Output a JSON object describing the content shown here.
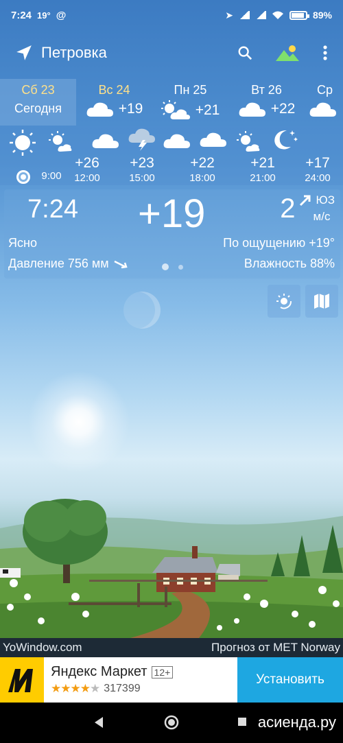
{
  "statusbar": {
    "time": "7:24",
    "temp_small": "19°",
    "battery": "89%"
  },
  "appbar": {
    "location": "Петровка"
  },
  "days": [
    {
      "name": "Сб 23",
      "sub": "Сегодня",
      "temp": "",
      "active": true
    },
    {
      "name": "Вс 24",
      "sub": "",
      "temp": "+19",
      "icon": "cloud-icon"
    },
    {
      "name": "Пн 25",
      "sub": "",
      "temp": "+21",
      "icon": "sun-cloud-icon"
    },
    {
      "name": "Вт 26",
      "sub": "",
      "temp": "+22",
      "icon": "cloud-icon"
    },
    {
      "name": "Ср",
      "sub": "",
      "temp": "",
      "icon": "cloud-icon"
    }
  ],
  "hours": [
    {
      "time": "9:00",
      "temp": "",
      "icon": "sun-icon"
    },
    {
      "time": "12:00",
      "temp": "+26",
      "icon": "sun-small-cloud-icon"
    },
    {
      "time": "15:00",
      "temp": "+23",
      "icon": "thunder-cloud-icon"
    },
    {
      "time": "18:00",
      "temp": "+22",
      "icon": "cloud-icon"
    },
    {
      "time": "21:00",
      "temp": "+21",
      "icon": "sun-small-cloud-icon"
    },
    {
      "time": "24:00",
      "temp": "+17",
      "icon": "moon-stars-icon"
    }
  ],
  "current": {
    "time": "7:24",
    "temp": "+19",
    "wind_speed": "2",
    "wind_unit": "м/с",
    "wind_dir": "ЮЗ",
    "condition": "Ясно",
    "feels_like": "По ощущению +19°",
    "pressure": "Давление 756 мм",
    "humidity": "Влажность 88%"
  },
  "credits": {
    "left": "YoWindow.com",
    "right": "Прогноз от MET Norway"
  },
  "ad": {
    "title": "Яндекс Маркет",
    "age": "12+",
    "rating_count": "317399",
    "rating": 4,
    "cta": "Установить"
  },
  "watermark": "асиенда.ру"
}
